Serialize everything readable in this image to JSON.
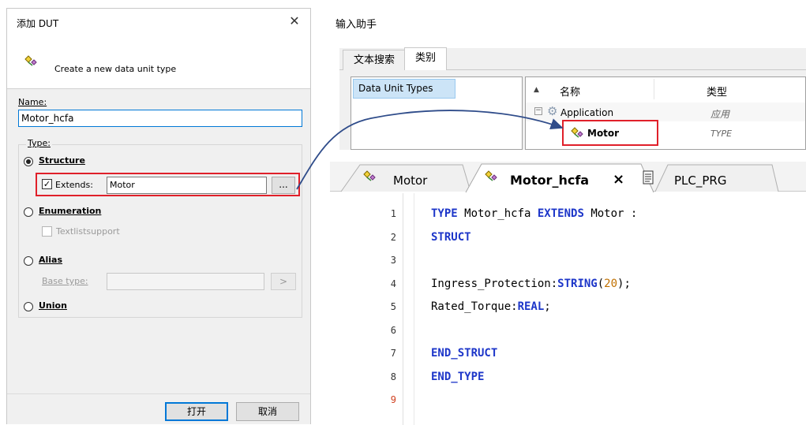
{
  "dialog": {
    "title": "添加 DUT",
    "close": "✕",
    "header_text": "Create a new data unit type",
    "name_label": "Name:",
    "name_value": "Motor_hcfa",
    "type_label": "Type:",
    "options": {
      "structure": "Structure",
      "extends_label": "Extends:",
      "extends_value": "Motor",
      "browse": "...",
      "enumeration": "Enumeration",
      "textlist": "Textlistsupport",
      "alias": "Alias",
      "base_type_label": "Base type:",
      "base_type_btn": ">",
      "union": "Union"
    },
    "ok": "打开",
    "cancel": "取消"
  },
  "helper": {
    "title": "输入助手",
    "tabs": [
      "文本搜索",
      "类别"
    ],
    "category": "Data Unit Types",
    "col_name": "名称",
    "col_type": "类型",
    "tree": [
      {
        "name": "Application",
        "type": "应用"
      },
      {
        "name": "Motor",
        "type": "TYPE"
      }
    ]
  },
  "editor": {
    "tabs": [
      "Motor",
      "Motor_hcfa",
      "PLC_PRG"
    ],
    "close": "×",
    "line_numbers": [
      "1",
      "2",
      "3",
      "4",
      "5",
      "6",
      "7",
      "8",
      "9"
    ],
    "lines": {
      "l1_kw1": "TYPE",
      "l1_name": " Motor_hcfa ",
      "l1_kw2": "EXTENDS",
      "l1_rest": " Motor :",
      "l2_kw": "STRUCT",
      "l4_name": "Ingress_Protection:",
      "l4_kw": "STRING",
      "l4_open": "(",
      "l4_num": "20",
      "l4_close": ");",
      "l5_name": "Rated_Torque:",
      "l5_kw": "REAL",
      "l5_end": ";",
      "l7_kw": "END_STRUCT",
      "l8_kw": "END_TYPE"
    }
  },
  "colors": {
    "highlight": "#e0202a",
    "arrow": "#2f4c8a",
    "keyword": "#1d36c9",
    "number": "#c07000"
  }
}
